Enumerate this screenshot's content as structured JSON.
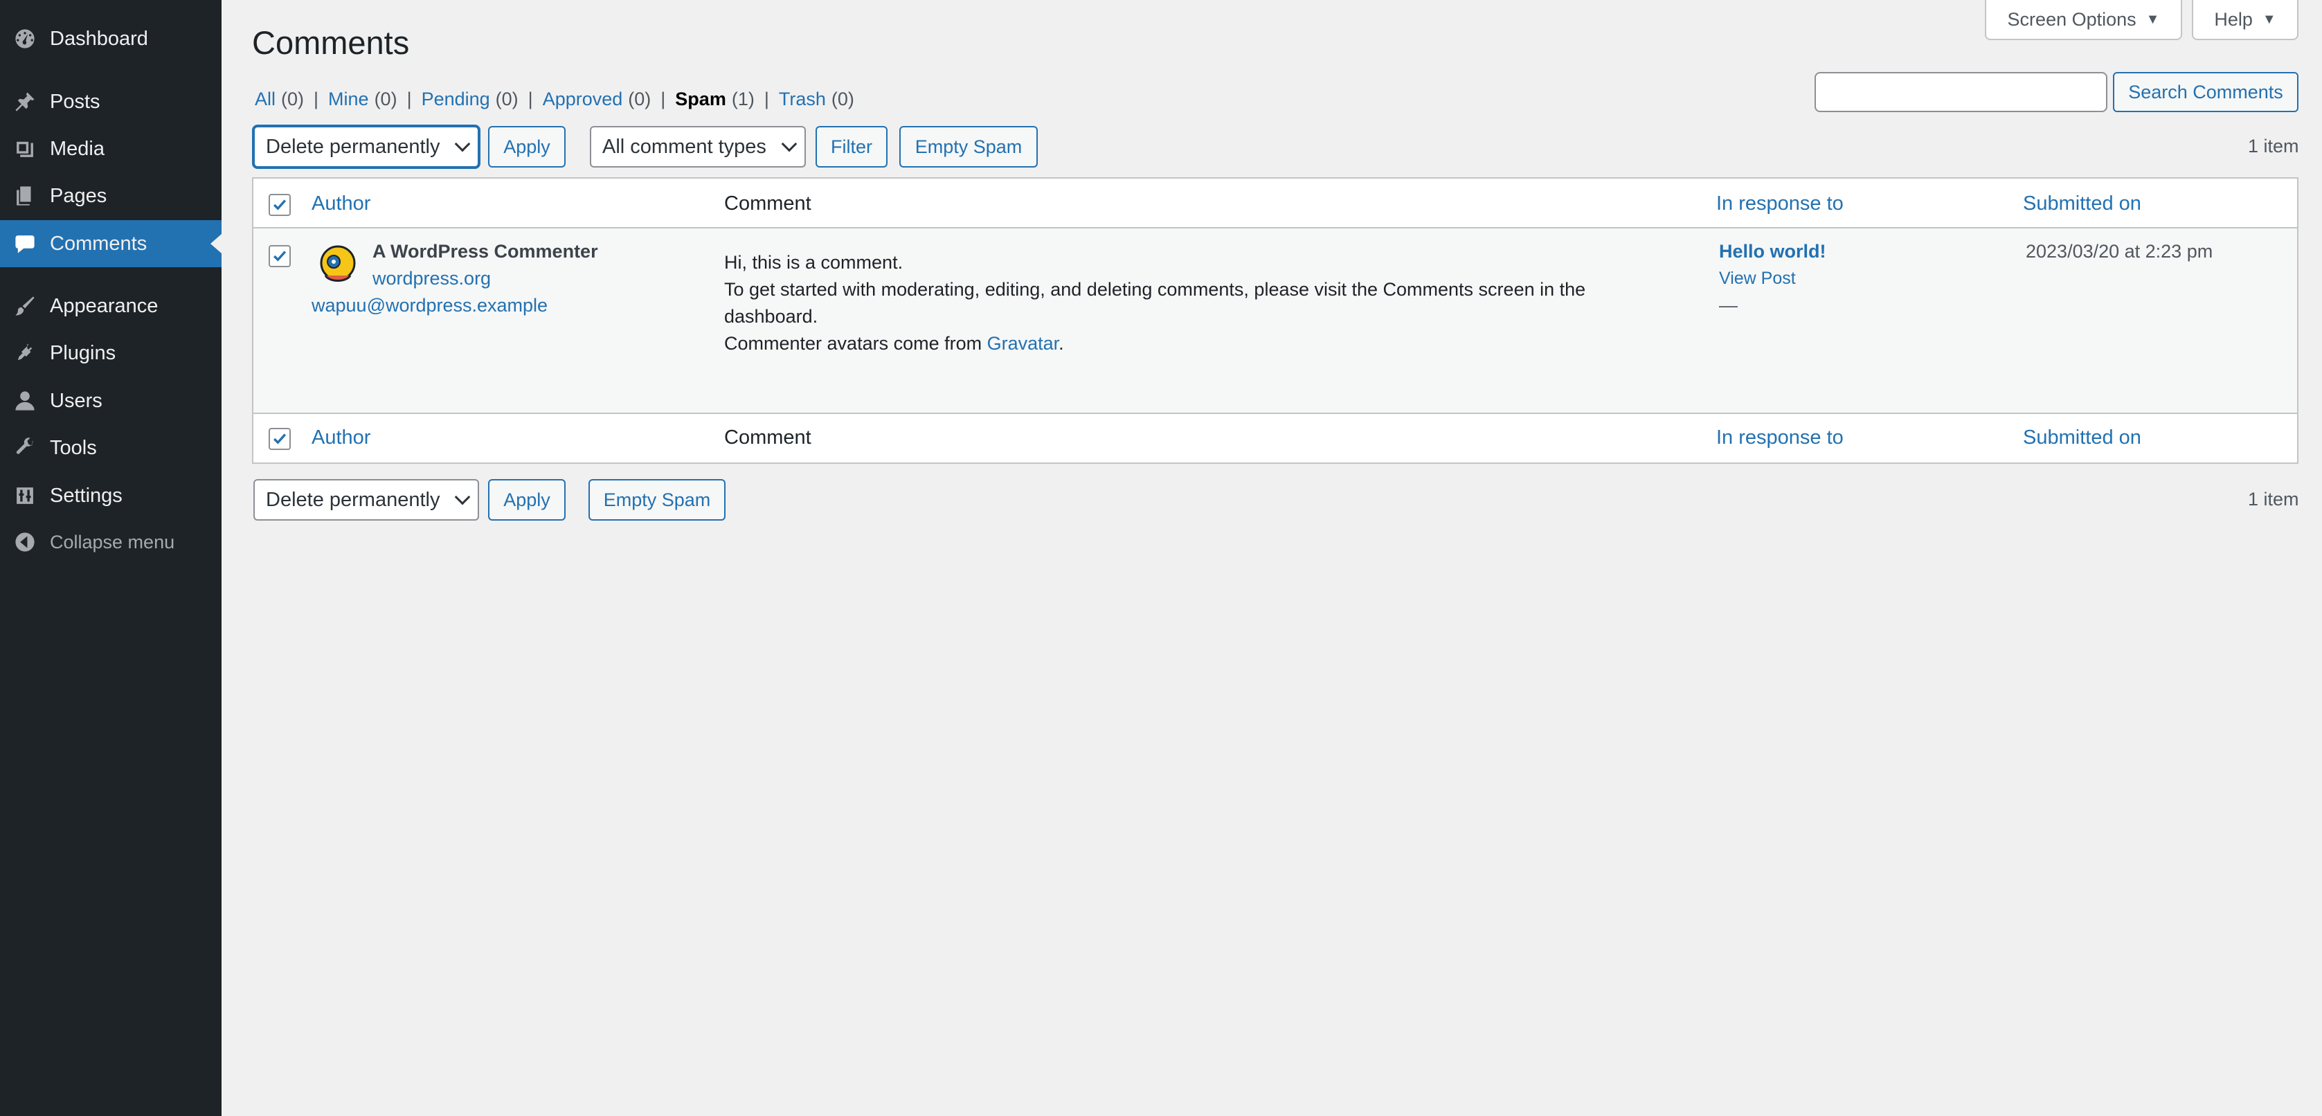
{
  "sidebar": {
    "items": [
      {
        "label": "Dashboard",
        "icon": "dashboard-icon"
      },
      {
        "label": "Posts",
        "icon": "pin-icon"
      },
      {
        "label": "Media",
        "icon": "media-icon"
      },
      {
        "label": "Pages",
        "icon": "pages-icon"
      },
      {
        "label": "Comments",
        "icon": "comment-icon",
        "current": true
      },
      {
        "label": "Appearance",
        "icon": "brush-icon"
      },
      {
        "label": "Plugins",
        "icon": "plugin-icon"
      },
      {
        "label": "Users",
        "icon": "user-icon"
      },
      {
        "label": "Tools",
        "icon": "wrench-icon"
      },
      {
        "label": "Settings",
        "icon": "settings-icon"
      },
      {
        "label": "Collapse menu",
        "icon": "collapse-icon"
      }
    ]
  },
  "header": {
    "screen_options": "Screen Options",
    "help": "Help",
    "title": "Comments"
  },
  "filters": {
    "all": {
      "label": "All",
      "count": "(0)"
    },
    "mine": {
      "label": "Mine",
      "count": "(0)"
    },
    "pending": {
      "label": "Pending",
      "count": "(0)"
    },
    "approved": {
      "label": "Approved",
      "count": "(0)"
    },
    "spam": {
      "label": "Spam",
      "count": "(1)"
    },
    "trash": {
      "label": "Trash",
      "count": "(0)"
    },
    "separator": "|"
  },
  "search": {
    "value": "",
    "button": "Search Comments"
  },
  "top_actions": {
    "bulk_action": "Delete permanently",
    "apply": "Apply",
    "comment_type": "All comment types",
    "filter": "Filter",
    "empty_spam": "Empty Spam",
    "item_count": "1 item"
  },
  "table": {
    "columns": {
      "author": "Author",
      "comment": "Comment",
      "in_response_to": "In response to",
      "submitted_on": "Submitted on"
    },
    "rows": [
      {
        "author_name": "A WordPress Commenter",
        "author_url": "wordpress.org",
        "author_email": "wapuu@wordpress.example",
        "comment_line1": "Hi, this is a comment.",
        "comment_line2a": "To get started with moderating, editing, and deleting comments, please visit the Comments screen in the",
        "comment_line2b": "dashboard.",
        "comment_line3_prefix": "Commenter avatars come from ",
        "comment_line3_link": "Gravatar",
        "comment_line3_suffix": ".",
        "response_title": "Hello world!",
        "view_post": "View Post",
        "response_dash": "—",
        "submitted": "2023/03/20 at 2:23 pm"
      }
    ]
  },
  "bottom_actions": {
    "bulk_action": "Delete permanently",
    "apply": "Apply",
    "empty_spam": "Empty Spam",
    "item_count": "1 item"
  },
  "colors": {
    "sidebar_bg": "#1d2327",
    "accent": "#2271b1",
    "page_bg": "#f0f0f1"
  }
}
